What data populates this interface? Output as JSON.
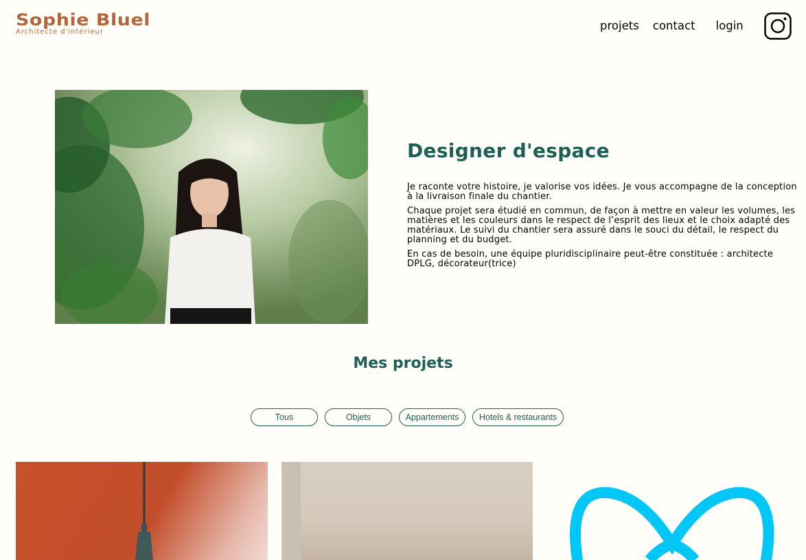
{
  "header": {
    "brand": "Sophie Bluel",
    "tagline": "Architecte d'intérieur",
    "nav": {
      "projets": "projets",
      "contact": "contact",
      "login": "login"
    },
    "social_icon": "instagram-icon"
  },
  "intro": {
    "title": "Designer d'espace",
    "paragraphs": [
      "Je raconte votre histoire, je valorise vos idées. Je vous accompagne de la conception à la livraison finale du chantier.",
      "Chaque projet sera étudié en commun, de façon à mettre en valeur les volumes, les matières et les couleurs dans le respect de l’esprit des lieux et le choix adapté des matériaux. Le suivi du chantier sera assuré dans le souci du détail, le respect du planning et du budget.",
      "En cas de besoin, une équipe pluridisciplinaire peut-être constituée : architecte DPLG, décorateur(trice)"
    ]
  },
  "projects": {
    "title": "Mes projets",
    "filters": [
      "Tous",
      "Objets",
      "Appartements",
      "Hotels & restaurants"
    ]
  },
  "colors": {
    "accent": "#B1663C",
    "primary": "#1D6154",
    "background": "#FFFEF8"
  }
}
